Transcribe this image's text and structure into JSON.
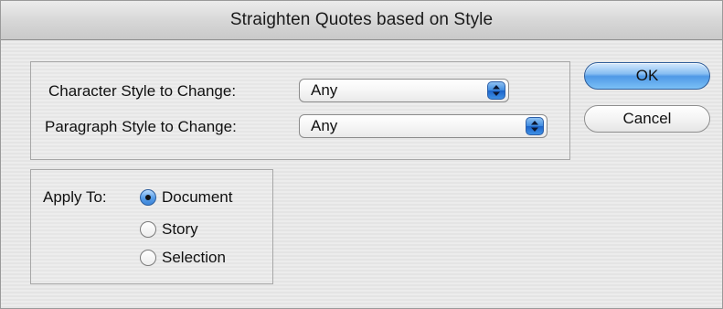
{
  "window": {
    "title": "Straighten Quotes based on Style"
  },
  "styles_group": {
    "character_label": "Character Style to Change:",
    "character_value": "Any",
    "paragraph_label": "Paragraph Style to Change:",
    "paragraph_value": "Any"
  },
  "buttons": {
    "ok_label": "OK",
    "cancel_label": "Cancel"
  },
  "apply_group": {
    "label": "Apply To:",
    "options": [
      {
        "label": "Document",
        "selected": true
      },
      {
        "label": "Story",
        "selected": false
      },
      {
        "label": "Selection",
        "selected": false
      }
    ]
  },
  "colors": {
    "accent": "#4f99e6",
    "window_bg": "#ececec"
  },
  "icons": {
    "popup_arrows": "updown-arrows-icon",
    "radio_selected": "radio-selected-icon",
    "radio_empty": "radio-empty-icon"
  }
}
